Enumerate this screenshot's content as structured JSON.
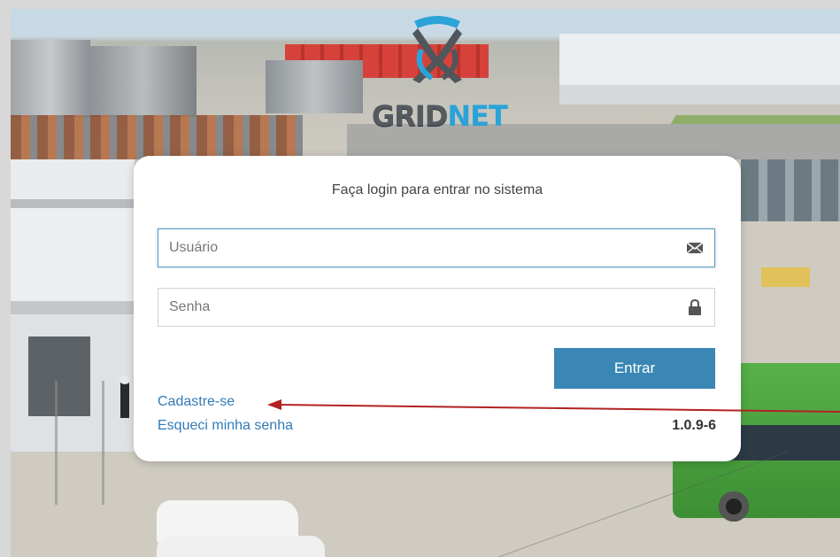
{
  "brand": {
    "logo_part1": "GRID",
    "logo_part2": "NET",
    "accent_color": "#3a87b5",
    "logo_blue": "#2aa3d8",
    "logo_gray": "#545a60"
  },
  "login": {
    "title": "Faça login para entrar no sistema",
    "username_placeholder": "Usuário",
    "username_value": "",
    "username_icon": "envelope-icon",
    "password_placeholder": "Senha",
    "password_value": "",
    "password_icon": "lock-icon",
    "submit_label": "Entrar",
    "signup_link": "Cadastre-se",
    "forgot_link": "Esqueci minha senha",
    "version": "1.0.9-6"
  },
  "annotation": {
    "arrow_color": "#b22222",
    "target": "signup_link"
  }
}
